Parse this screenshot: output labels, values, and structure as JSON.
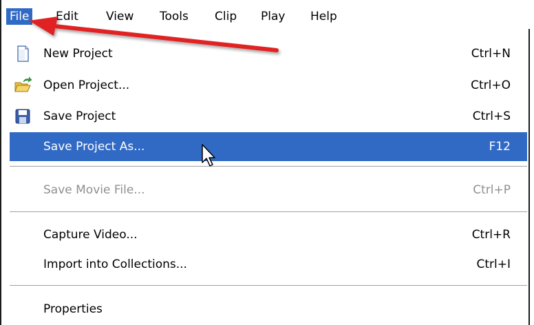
{
  "menubar": {
    "items": [
      "File",
      "Edit",
      "View",
      "Tools",
      "Clip",
      "Play",
      "Help"
    ],
    "active_index": 0
  },
  "file_menu": {
    "items": [
      {
        "label": "New Project",
        "shortcut": "Ctrl+N",
        "icon": "new-project-icon",
        "state": "normal"
      },
      {
        "label": "Open Project...",
        "shortcut": "Ctrl+O",
        "icon": "open-folder-icon",
        "state": "normal"
      },
      {
        "label": "Save Project",
        "shortcut": "Ctrl+S",
        "icon": "floppy-disk-icon",
        "state": "normal"
      },
      {
        "label": "Save Project As...",
        "shortcut": "F12",
        "icon": "",
        "state": "highlighted"
      },
      {
        "label": "Save Movie File...",
        "shortcut": "Ctrl+P",
        "icon": "",
        "state": "disabled"
      },
      {
        "label": "Capture Video...",
        "shortcut": "Ctrl+R",
        "icon": "",
        "state": "normal"
      },
      {
        "label": "Import into Collections...",
        "shortcut": "Ctrl+I",
        "icon": "",
        "state": "normal"
      },
      {
        "label": "Properties",
        "shortcut": "",
        "icon": "",
        "state": "normal"
      }
    ]
  },
  "annotation": {
    "type": "red-arrow",
    "points_to": "File",
    "color": "#e02020"
  },
  "cursor": {
    "type": "arrow-pointer"
  },
  "colors": {
    "highlight": "#316ac5",
    "disabled_text": "#8f8f8f",
    "frame": "#1a1a1a"
  }
}
